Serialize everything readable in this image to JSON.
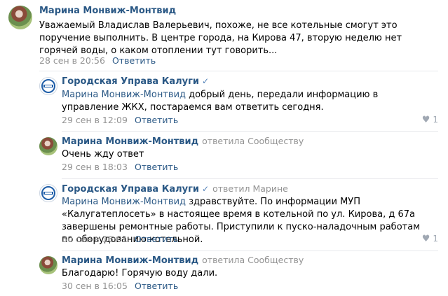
{
  "comments": [
    {
      "author": "Марина Монвиж-Монтвид",
      "text": "Уважаемый Владислав Валерьевич, похоже, не все котельные смогут это поручение выполнить. В центре города, на Кирова 47, вторую неделю нет горячей воды, о каком отоплении тут говорить...",
      "date": "28 сен в 20:56",
      "reply_label": "Ответить"
    },
    {
      "author": "Городская Управа Калуги",
      "verified_icon": "check-icon",
      "mention": "Марина Монвиж-Монтвид",
      "text": " добрый день, передали информацию в управление ЖКХ, постараемся вам ответить сегодня.",
      "date": "29 сен в 12:09",
      "reply_label": "Ответить",
      "likes": "1"
    },
    {
      "author": "Марина Монвиж-Монтвид",
      "replied_to": "ответила Сообществу",
      "text": "Очень жду ответ",
      "date": "29 сен в 18:03",
      "reply_label": "Ответить"
    },
    {
      "author": "Городская Управа Калуги",
      "verified_icon": "check-icon",
      "replied_to": "ответил Марине",
      "mention": "Марина Монвиж-Монтвид",
      "text": " здравствуйте. По информации МУП «Калугатеплосеть» в настоящее время в котельной по ул. Кирова, д 67а завершены ремонтные работы. Приступили к пуско-наладочным работам по оборудованию котельной.",
      "date": "30 сен в 16:01",
      "reply_label": "Ответить",
      "likes": "1"
    },
    {
      "author": "Марина Монвиж-Монтвид",
      "replied_to": "ответила Сообществу",
      "text": "Благодарю! Горячую воду дали.",
      "date": "30 сен в 16:05",
      "reply_label": "Ответить"
    }
  ],
  "colors": {
    "link": "#2a5885",
    "meta": "#939393",
    "divider": "#e7e8ec",
    "verified": "#5181b8"
  }
}
